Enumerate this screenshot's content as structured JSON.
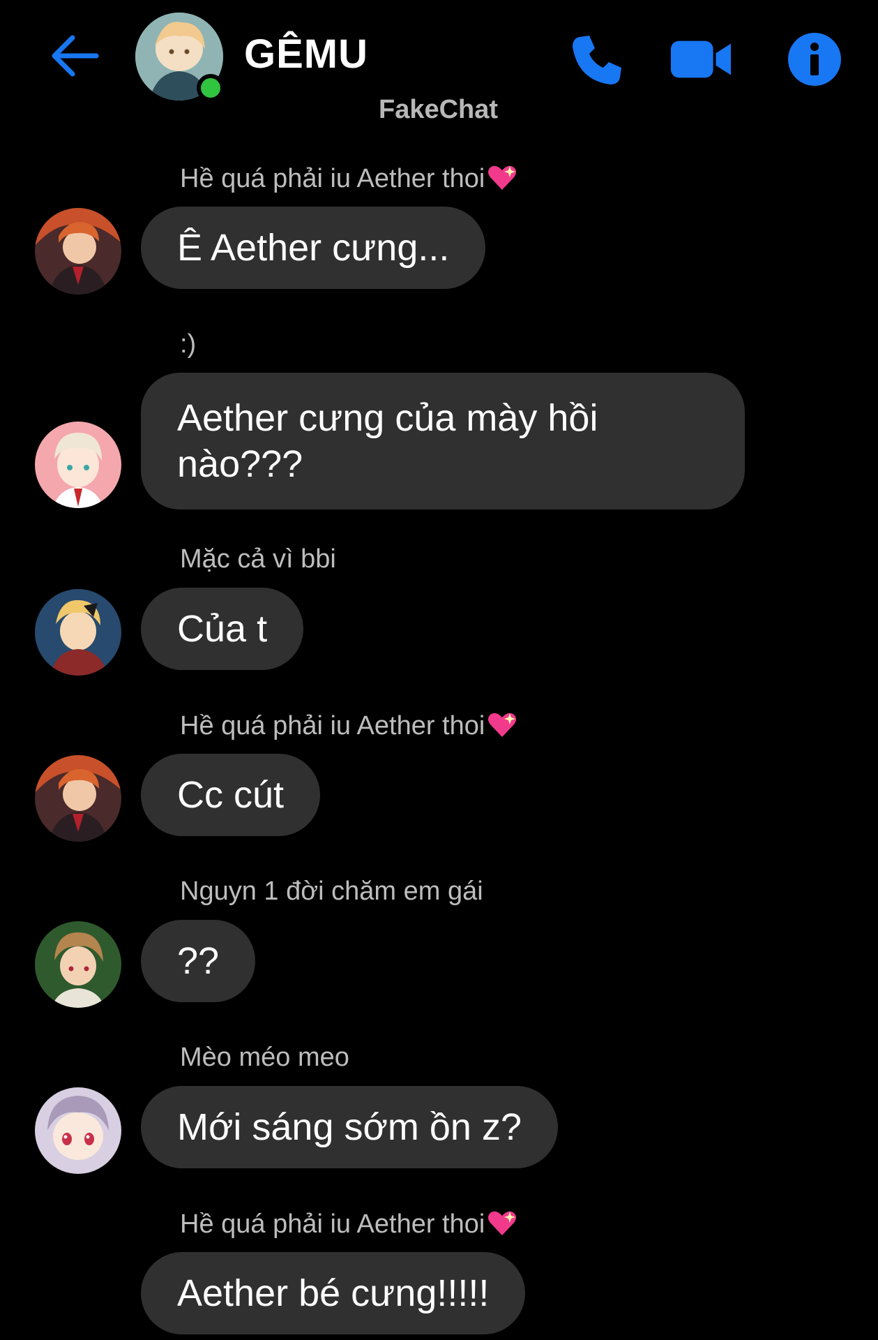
{
  "header": {
    "title": "GÊMU",
    "watermark": "FakeChat",
    "back_icon": "arrow-left-icon",
    "call_icon": "phone-icon",
    "video_icon": "video-camera-icon",
    "info_icon": "info-icon",
    "accent_color": "#1877f2",
    "online_color": "#31c43f"
  },
  "messages": [
    {
      "sender": "Hề quá phải iu Aether thoi",
      "sender_emoji": "sparkling-heart-icon",
      "text": "Ê Aether cưng..."
    },
    {
      "sender": ":)",
      "text": "Aether cưng của mày hồi nào???"
    },
    {
      "sender": "Mặc cả vì bbi",
      "text": "Của t"
    },
    {
      "sender": "Hề quá phải iu Aether thoi",
      "sender_emoji": "sparkling-heart-icon",
      "text": "Cc cút"
    },
    {
      "sender": "Nguyn 1 đời chăm em gái",
      "text": "??"
    },
    {
      "sender": "Mèo méo meo",
      "text": "Mới sáng sớm ồn z?"
    },
    {
      "sender": "Hề quá phải iu Aether thoi",
      "sender_emoji": "sparkling-heart-icon",
      "text": "Aether bé cưng!!!!!"
    }
  ],
  "colors": {
    "background": "#000000",
    "bubble": "#303030",
    "sender_text": "#bdbdbd"
  }
}
